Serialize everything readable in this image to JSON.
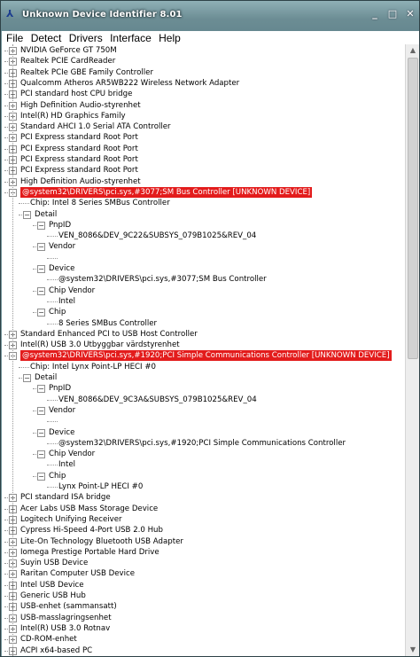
{
  "window": {
    "title": "Unknown Device Identifier 8.01",
    "controls": [
      "_",
      "□",
      "✕"
    ]
  },
  "menu": [
    "File",
    "Detect",
    "Drivers",
    "Interface",
    "Help"
  ],
  "tree": [
    {
      "level": 0,
      "toggle": "+",
      "text": "NVIDIA GeForce GT 750M"
    },
    {
      "level": 0,
      "toggle": "+",
      "text": "Realtek PCIE CardReader"
    },
    {
      "level": 0,
      "toggle": "+",
      "text": "Realtek PCIe GBE Family Controller"
    },
    {
      "level": 0,
      "toggle": "+",
      "text": "Qualcomm Atheros AR5WB222 Wireless Network Adapter"
    },
    {
      "level": 0,
      "toggle": "+",
      "text": "PCI standard host CPU bridge"
    },
    {
      "level": 0,
      "toggle": "+",
      "text": "High Definition Audio-styrenhet"
    },
    {
      "level": 0,
      "toggle": "+",
      "text": "Intel(R) HD Graphics Family"
    },
    {
      "level": 0,
      "toggle": "+",
      "text": "Standard AHCI 1.0 Serial ATA Controller"
    },
    {
      "level": 0,
      "toggle": "+",
      "text": "PCI Express standard Root Port"
    },
    {
      "level": 0,
      "toggle": "+",
      "text": "PCI Express standard Root Port"
    },
    {
      "level": 0,
      "toggle": "+",
      "text": "PCI Express standard Root Port"
    },
    {
      "level": 0,
      "toggle": "+",
      "text": "PCI Express standard Root Port"
    },
    {
      "level": 0,
      "toggle": "+",
      "text": "High Definition Audio-styrenhet"
    },
    {
      "level": 0,
      "toggle": "−",
      "text": "@system32\\DRIVERS\\pci.sys,#3077;SM Bus Controller [UNKNOWN DEVICE]",
      "highlight": true
    },
    {
      "level": 1,
      "toggle": "",
      "text": "Chip: Intel  8 Series SMBus Controller"
    },
    {
      "level": 1,
      "toggle": "−",
      "text": "Detail"
    },
    {
      "level": 2,
      "toggle": "−",
      "text": "PnpID"
    },
    {
      "level": 3,
      "toggle": "",
      "text": "VEN_8086&DEV_9C22&SUBSYS_079B1025&REV_04"
    },
    {
      "level": 2,
      "toggle": "−",
      "text": "Vendor"
    },
    {
      "level": 3,
      "toggle": "",
      "text": ""
    },
    {
      "level": 2,
      "toggle": "−",
      "text": "Device"
    },
    {
      "level": 3,
      "toggle": "",
      "text": "@system32\\DRIVERS\\pci.sys,#3077;SM Bus Controller"
    },
    {
      "level": 2,
      "toggle": "−",
      "text": "Chip Vendor"
    },
    {
      "level": 3,
      "toggle": "",
      "text": "Intel"
    },
    {
      "level": 2,
      "toggle": "−",
      "text": "Chip"
    },
    {
      "level": 3,
      "toggle": "",
      "text": "8 Series SMBus Controller"
    },
    {
      "level": 0,
      "toggle": "+",
      "text": "Standard Enhanced PCI to USB Host Controller"
    },
    {
      "level": 0,
      "toggle": "+",
      "text": "Intel(R) USB 3.0 Utbyggbar värdstyrenhet"
    },
    {
      "level": 0,
      "toggle": "−",
      "text": "@system32\\DRIVERS\\pci.sys,#1920;PCI Simple Communications Controller [UNKNOWN DEVICE]",
      "highlight": true
    },
    {
      "level": 1,
      "toggle": "",
      "text": "Chip: Intel  Lynx Point-LP HECI #0"
    },
    {
      "level": 1,
      "toggle": "−",
      "text": "Detail"
    },
    {
      "level": 2,
      "toggle": "−",
      "text": "PnpID"
    },
    {
      "level": 3,
      "toggle": "",
      "text": "VEN_8086&DEV_9C3A&SUBSYS_079B1025&REV_04"
    },
    {
      "level": 2,
      "toggle": "−",
      "text": "Vendor"
    },
    {
      "level": 3,
      "toggle": "",
      "text": ""
    },
    {
      "level": 2,
      "toggle": "−",
      "text": "Device"
    },
    {
      "level": 3,
      "toggle": "",
      "text": "@system32\\DRIVERS\\pci.sys,#1920;PCI Simple Communications Controller"
    },
    {
      "level": 2,
      "toggle": "−",
      "text": "Chip Vendor"
    },
    {
      "level": 3,
      "toggle": "",
      "text": "Intel"
    },
    {
      "level": 2,
      "toggle": "−",
      "text": "Chip"
    },
    {
      "level": 3,
      "toggle": "",
      "text": "Lynx Point-LP HECI #0"
    },
    {
      "level": 0,
      "toggle": "+",
      "text": "PCI standard ISA bridge"
    },
    {
      "level": 0,
      "toggle": "+",
      "text": "Acer Labs USB Mass Storage Device"
    },
    {
      "level": 0,
      "toggle": "+",
      "text": "Logitech Unifying Receiver"
    },
    {
      "level": 0,
      "toggle": "+",
      "text": "Cypress Hi-Speed 4-Port USB 2.0 Hub"
    },
    {
      "level": 0,
      "toggle": "+",
      "text": "Lite-On Technology Bluetooth USB Adapter"
    },
    {
      "level": 0,
      "toggle": "+",
      "text": "Iomega Prestige Portable Hard Drive"
    },
    {
      "level": 0,
      "toggle": "+",
      "text": "Suyin USB Device"
    },
    {
      "level": 0,
      "toggle": "+",
      "text": "Raritan Computer USB Device"
    },
    {
      "level": 0,
      "toggle": "+",
      "text": "Intel USB Device"
    },
    {
      "level": 0,
      "toggle": "+",
      "text": "Generic USB Hub"
    },
    {
      "level": 0,
      "toggle": "+",
      "text": "USB-enhet (sammansatt)"
    },
    {
      "level": 0,
      "toggle": "+",
      "text": "USB-masslagringsenhet"
    },
    {
      "level": 0,
      "toggle": "+",
      "text": "Intel(R) USB 3.0 Rotnav"
    },
    {
      "level": 0,
      "toggle": "+",
      "text": "CD-ROM-enhet"
    },
    {
      "level": 0,
      "toggle": "+",
      "text": "ACPI x64-based PC"
    }
  ],
  "colors": {
    "highlight": "#e31c1c",
    "titlebar": "#6f9097"
  }
}
